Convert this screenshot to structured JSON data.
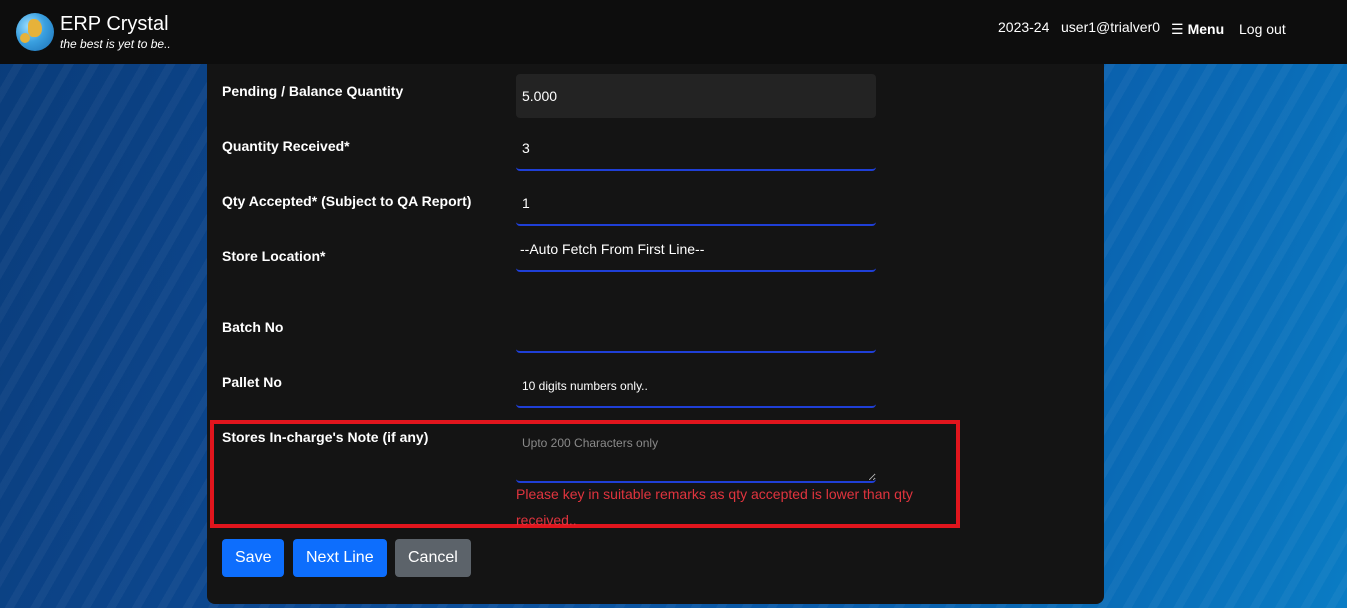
{
  "header": {
    "app_name": "ERP Crystal",
    "tagline": "the best is yet to be..",
    "fiscal_year": "2023-24",
    "user": "user1@trialver0",
    "menu_icon": "hamburger-icon",
    "menu_label": "Menu",
    "logout_label": "Log out"
  },
  "form": {
    "pending_balance": {
      "label": "Pending / Balance Quantity",
      "value": "5.000"
    },
    "quantity_received": {
      "label": "Quantity Received*",
      "value": "3"
    },
    "qty_accepted": {
      "label": "Qty Accepted* (Subject to QA Report)",
      "value": "1"
    },
    "store_location": {
      "label": "Store Location*",
      "value": "--Auto Fetch From First Line--"
    },
    "batch_no": {
      "label": "Batch No",
      "value": ""
    },
    "pallet_no": {
      "label": "Pallet No",
      "placeholder": "10 digits numbers only.."
    },
    "stores_note": {
      "label": "Stores In-charge's Note (if any)",
      "placeholder": "Upto 200 Characters only",
      "error": "Please key in suitable remarks as qty accepted is lower than qty received.."
    }
  },
  "buttons": {
    "save": "Save",
    "next_line": "Next Line",
    "cancel": "Cancel"
  },
  "colors": {
    "primary": "#0d6efd",
    "secondary": "#5c636a",
    "error": "#e0343e",
    "highlight_border": "#e0151d",
    "field_underline": "#1f3fd6"
  }
}
